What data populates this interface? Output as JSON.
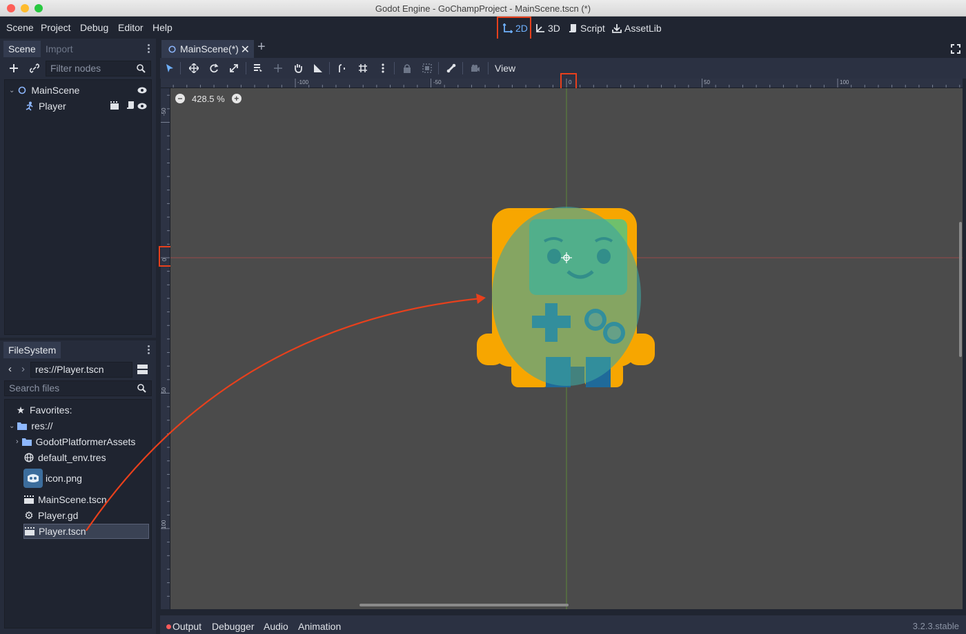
{
  "window": {
    "title": "Godot Engine - GoChampProject - MainScene.tscn (*)"
  },
  "menu": [
    "Scene",
    "Project",
    "Debug",
    "Editor",
    "Help"
  ],
  "workspaces": {
    "two_d": "2D",
    "three_d": "3D",
    "script": "Script",
    "assetlib": "AssetLib"
  },
  "scene_dock": {
    "tabs": [
      "Scene",
      "Import"
    ],
    "filter_placeholder": "Filter nodes",
    "nodes": [
      {
        "label": "MainScene",
        "icon": "node2d-icon"
      },
      {
        "label": "Player",
        "icon": "kinematic-body-icon"
      }
    ]
  },
  "filesystem": {
    "tab": "FileSystem",
    "path": "res://Player.tscn",
    "search_placeholder": "Search files",
    "favorites_label": "Favorites:",
    "root": "res://",
    "items": [
      "GodotPlatformerAssets",
      "default_env.tres",
      "icon.png",
      "MainScene.tscn",
      "Player.gd",
      "Player.tscn"
    ],
    "selected": "Player.tscn"
  },
  "editor": {
    "scene_tab": "MainScene(*)",
    "view_menu": "View",
    "zoom": "428.5 %",
    "ruler_h_labels": [
      "-100",
      "-50",
      "0",
      "50",
      "100"
    ],
    "ruler_v_labels": [
      "-50",
      "0",
      "50",
      "100"
    ]
  },
  "bottom_panel": {
    "tabs": [
      "Output",
      "Debugger",
      "Audio",
      "Animation"
    ],
    "version": "3.2.3.stable"
  },
  "colors": {
    "accent": "#6fb1ff",
    "highlight": "#e8401c",
    "viewport": "#4b4b4b",
    "sprite_orange": "#f7a600",
    "collision_shape": "#3fa59e"
  }
}
